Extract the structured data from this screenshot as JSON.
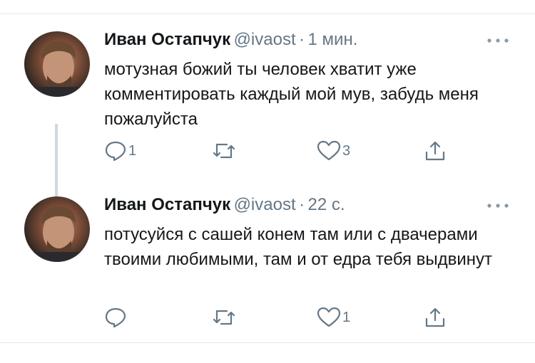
{
  "tweets": [
    {
      "name": "Иван Остапчук",
      "handle": "@ivaost",
      "separator": "·",
      "time": "1 мин.",
      "text": "мотузная божий ты человек хватит уже комментировать каждый мой мув, забудь меня пожалуйста",
      "reply_count": "1",
      "retweet_count": "",
      "like_count": "3"
    },
    {
      "name": "Иван Остапчук",
      "handle": "@ivaost",
      "separator": "·",
      "time": "22 с.",
      "text": "потусуйся с сашей конем там или с двачерами твоими любимыми, там и от едра тебя выдвинут",
      "reply_count": "",
      "retweet_count": "",
      "like_count": "1"
    }
  ],
  "icons": {
    "reply": "reply-icon",
    "retweet": "retweet-icon",
    "like": "like-icon",
    "share": "share-icon",
    "more": "more-options-icon"
  },
  "colors": {
    "text": "#14171a",
    "secondary": "#657786",
    "divider": "#e1e8ed",
    "thread_line": "#cfd9de"
  }
}
